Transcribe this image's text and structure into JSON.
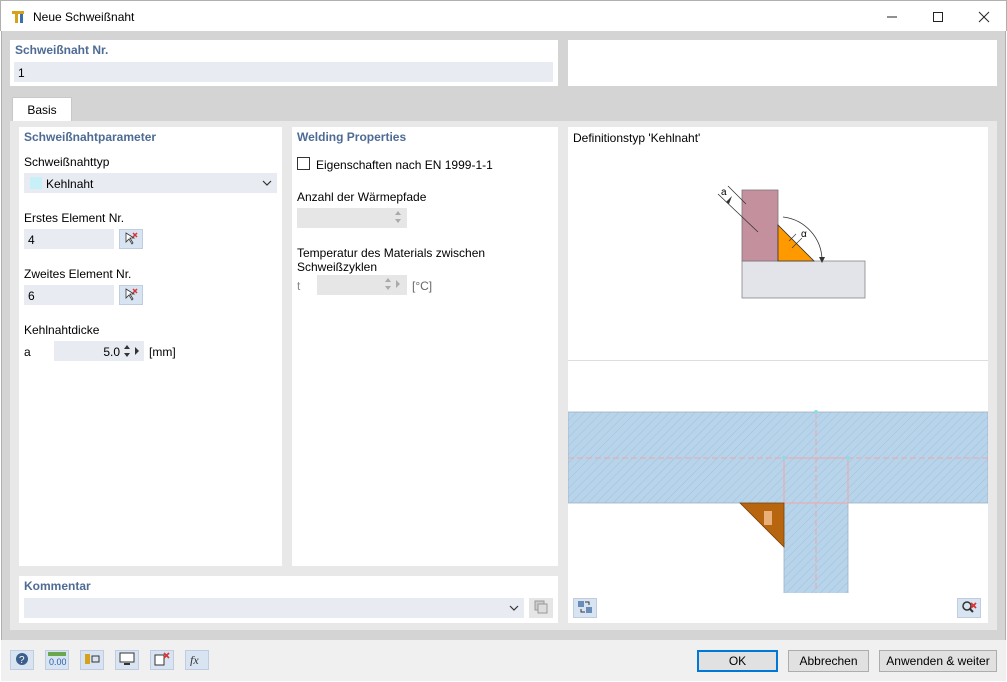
{
  "window": {
    "title": "Neue Schweißnaht",
    "minimize": "—",
    "maximize": "☐",
    "close": "✕"
  },
  "header": {
    "number_label": "Schweißnaht Nr.",
    "number_value": "1"
  },
  "tabs": [
    {
      "label": "Basis"
    }
  ],
  "params": {
    "title": "Schweißnahtparameter",
    "type_label": "Schweißnahttyp",
    "type_value": "Kehlnaht",
    "first_label": "Erstes Element Nr.",
    "first_value": "4",
    "second_label": "Zweites Element Nr.",
    "second_value": "6",
    "thickness_label": "Kehlnahtdicke",
    "thickness_symbol": "a",
    "thickness_value": "5.0",
    "thickness_unit": "[mm]"
  },
  "welding": {
    "title": "Welding Properties",
    "checkbox_label": "Eigenschaften nach EN 1999-1-1",
    "checkbox_checked": false,
    "paths_label": "Anzahl der Wärmepfade",
    "paths_value": "",
    "temp_label": "Temperatur des Materials zwischen Schweißzyklen",
    "temp_symbol": "t",
    "temp_value": "",
    "temp_unit": "[°C]"
  },
  "definition": {
    "title": "Definitionstyp 'Kehlnaht'",
    "label_a": "a",
    "label_alpha": "α"
  },
  "comment": {
    "label": "Kommentar",
    "value": ""
  },
  "footer": {
    "ok": "OK",
    "cancel": "Abbrechen",
    "apply": "Anwenden & weiter"
  },
  "icons": {
    "title": "weld-app-icon",
    "toolbar": [
      "help-icon",
      "units-icon",
      "display-icon",
      "view-icon",
      "delete-icon",
      "formula-icon"
    ]
  },
  "colors": {
    "accent_heading": "#4d6b94",
    "weld_fill": "#ff9900",
    "weld_fill_dark": "#b3600a",
    "plate_fill": "#c4909e",
    "section_fill": "#b8d4ea"
  }
}
